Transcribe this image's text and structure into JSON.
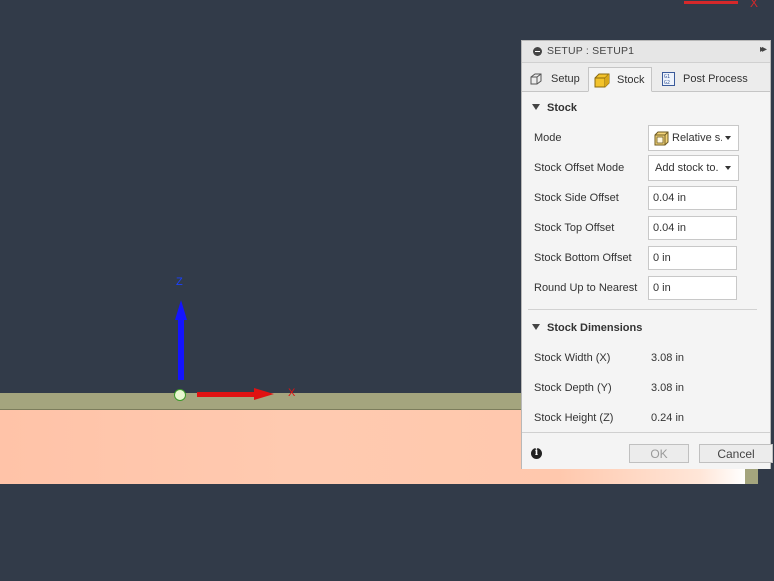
{
  "viewport": {
    "axis_z_label": "Z",
    "axis_x_label": "X",
    "corner_axis_label": "X"
  },
  "dialog": {
    "title": "SETUP : SETUP1",
    "expand_glyph": "▸▸",
    "tabs": [
      {
        "label": "Setup",
        "icon": "setup-icon",
        "active": false
      },
      {
        "label": "Stock",
        "icon": "stock-cube-icon",
        "active": true
      },
      {
        "label": "Post Process",
        "icon": "post-process-icon",
        "active": false
      }
    ],
    "stock_section": {
      "title": "Stock",
      "mode": {
        "label": "Mode",
        "value": "Relative s...",
        "icon": "relative-box-icon"
      },
      "offset_mode": {
        "label": "Stock Offset Mode",
        "value": "Add stock to..."
      },
      "side_offset": {
        "label": "Stock Side Offset",
        "value": "0.04 in"
      },
      "top_offset": {
        "label": "Stock Top Offset",
        "value": "0.04 in"
      },
      "bottom_offset": {
        "label": "Stock Bottom Offset",
        "value": "0 in"
      },
      "round_up": {
        "label": "Round Up to Nearest",
        "value": "0 in"
      }
    },
    "dimensions_section": {
      "title": "Stock Dimensions",
      "width": {
        "label": "Stock Width (X)",
        "value": "3.08 in"
      },
      "depth": {
        "label": "Stock Depth (Y)",
        "value": "3.08 in"
      },
      "height": {
        "label": "Stock Height (Z)",
        "value": "0.24 in"
      }
    },
    "footer": {
      "info_glyph": "i",
      "ok_label": "OK",
      "cancel_label": "Cancel"
    }
  },
  "colors": {
    "background": "#323b49",
    "stock_face": "#ffc3a8",
    "stock_top": "#a4a57e",
    "axis_x": "#e01212",
    "axis_z": "#1414ff"
  }
}
